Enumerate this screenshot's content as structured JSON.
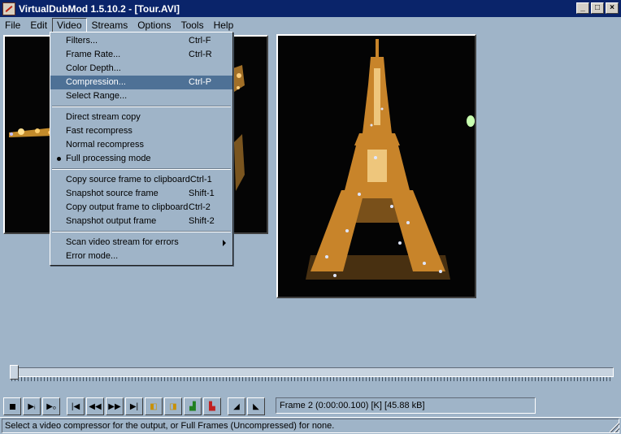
{
  "window": {
    "title": "VirtualDubMod 1.5.10.2 - [Tour.AVI]",
    "buttons": [
      "_",
      "□",
      "×"
    ]
  },
  "menubar": {
    "items": [
      "File",
      "Edit",
      "Video",
      "Streams",
      "Options",
      "Tools",
      "Help"
    ]
  },
  "video_menu": {
    "filters": {
      "label": "Filters...",
      "shortcut": "Ctrl-F"
    },
    "frame_rate": {
      "label": "Frame Rate...",
      "shortcut": "Ctrl-R"
    },
    "color_depth": {
      "label": "Color Depth...",
      "shortcut": ""
    },
    "compression": {
      "label": "Compression...",
      "shortcut": "Ctrl-P"
    },
    "select_range": {
      "label": "Select Range...",
      "shortcut": ""
    },
    "direct_stream_copy": {
      "label": "Direct stream copy"
    },
    "fast_recompress": {
      "label": "Fast recompress"
    },
    "normal_recompress": {
      "label": "Normal recompress"
    },
    "full_processing": {
      "label": "Full processing mode"
    },
    "copy_source": {
      "label": "Copy source frame to clipboard",
      "shortcut": "Ctrl-1"
    },
    "snapshot_source": {
      "label": "Snapshot source frame",
      "shortcut": "Shift-1"
    },
    "copy_output": {
      "label": "Copy output frame to clipboard",
      "shortcut": "Ctrl-2"
    },
    "snapshot_output": {
      "label": "Snapshot output frame",
      "shortcut": "Shift-2"
    },
    "scan_errors": {
      "label": "Scan video stream for errors"
    },
    "error_mode": {
      "label": "Error mode..."
    }
  },
  "frame_info": "Frame 2 (0:00:00.100) [K] [45.88 kB]",
  "status": "Select a video compressor for the output, or Full Frames (Uncompressed) for none.",
  "timeline": {
    "position_fraction": 0.0
  }
}
